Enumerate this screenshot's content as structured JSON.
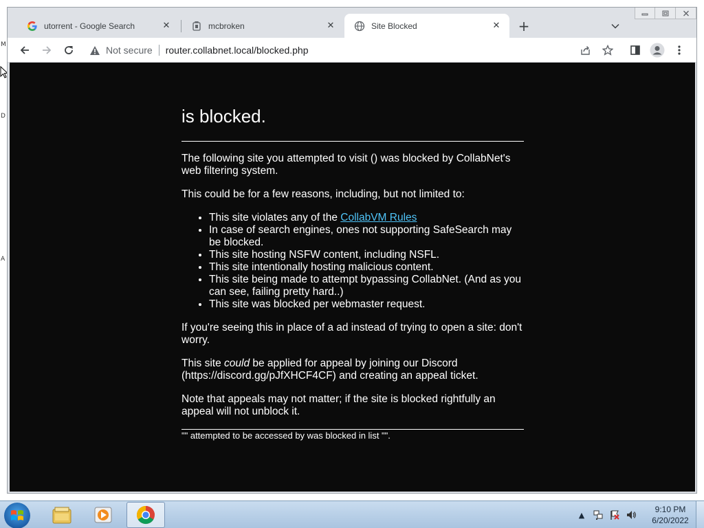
{
  "browser": {
    "tabs": [
      {
        "title": "utorrent - Google Search",
        "favicon": "google-g-icon"
      },
      {
        "title": "mcbroken",
        "favicon": "page-icon"
      },
      {
        "title": "Site Blocked",
        "favicon": "globe-icon"
      }
    ],
    "active_tab_index": 2,
    "security_label": "Not secure",
    "url": "router.collabnet.local/blocked.php",
    "window_controls": [
      "minimize-icon",
      "maximize-icon",
      "close-icon"
    ]
  },
  "page": {
    "heading": "is blocked.",
    "intro": "The following site you attempted to visit () was blocked by CollabNet's web filtering system.",
    "reasons_intro": "This could be for a few reasons, including, but not limited to:",
    "reason_1_prefix": "This site violates any of the ",
    "reason_1_link": "CollabVM Rules",
    "reasons": [
      "In case of search engines, ones not supporting SafeSearch may be blocked.",
      "This site hosting NSFW content, including NSFL.",
      "This site intentionally hosting malicious content.",
      "This site being made to attempt bypassing CollabNet. (And as you can see, failing pretty hard..)",
      "This site was blocked per webmaster request."
    ],
    "ad_note": "If you're seeing this in place of a ad instead of trying to open a site: don't worry.",
    "appeal_prefix": "This site ",
    "appeal_emphasis": "could",
    "appeal_suffix": " be applied for appeal by joining our Discord (https://discord.gg/pJfXHCF4CF) and creating an appeal ticket.",
    "appeal_note": "Note that appeals may not matter; if the site is blocked rightfully an appeal will not unblock it.",
    "footer": "\"\" attempted to be accessed by was blocked in list \"\"."
  },
  "taskbar": {
    "pinned": [
      "explorer-icon",
      "media-player-icon",
      "chrome-icon"
    ],
    "active": "chrome-icon",
    "clock_time": "9:10 PM",
    "clock_date": "6/20/2022"
  },
  "colors": {
    "page_bg": "#0b0b0b",
    "link": "#4fc3f7",
    "tabstrip": "#dee1e6"
  }
}
